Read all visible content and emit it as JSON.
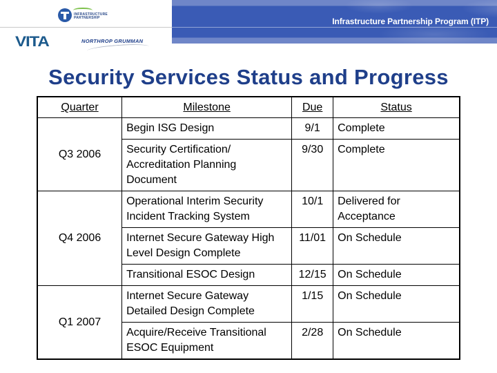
{
  "header": {
    "program_title": "Infrastructure Partnership Program (ITP)",
    "logos": {
      "itp": {
        "line1": "INFRASTRUCTURE",
        "line2": "PARTNERSHIP"
      },
      "vita": "VITA",
      "northrop": "NORTHROP GRUMMAN"
    },
    "colors": {
      "banner": "#3a5bb5",
      "title": "#1f3f8a"
    }
  },
  "title": "Security Services Status and Progress",
  "table": {
    "headers": [
      "Quarter",
      "Milestone",
      "Due",
      "Status"
    ],
    "groups": [
      {
        "quarter": "Q3 2006",
        "rows": [
          {
            "milestone": "Begin ISG Design",
            "due": "9/1",
            "status": "Complete"
          },
          {
            "milestone": "Security Certification/ Accreditation Planning Document",
            "due": "9/30",
            "status": "Complete"
          }
        ]
      },
      {
        "quarter": "Q4 2006",
        "rows": [
          {
            "milestone": "Operational Interim Security Incident Tracking System",
            "due": "10/1",
            "status": "Delivered for Acceptance"
          },
          {
            "milestone": "Internet Secure Gateway High Level Design Complete",
            "due": "11/01",
            "status": "On Schedule"
          },
          {
            "milestone": "Transitional ESOC Design",
            "due": "12/15",
            "status": "On Schedule"
          }
        ]
      },
      {
        "quarter": "Q1 2007",
        "rows": [
          {
            "milestone": "Internet Secure Gateway Detailed Design Complete",
            "due": "1/15",
            "status": "On Schedule"
          },
          {
            "milestone": "Acquire/Receive Transitional ESOC Equipment",
            "due": "2/28",
            "status": "On Schedule"
          }
        ]
      }
    ]
  }
}
